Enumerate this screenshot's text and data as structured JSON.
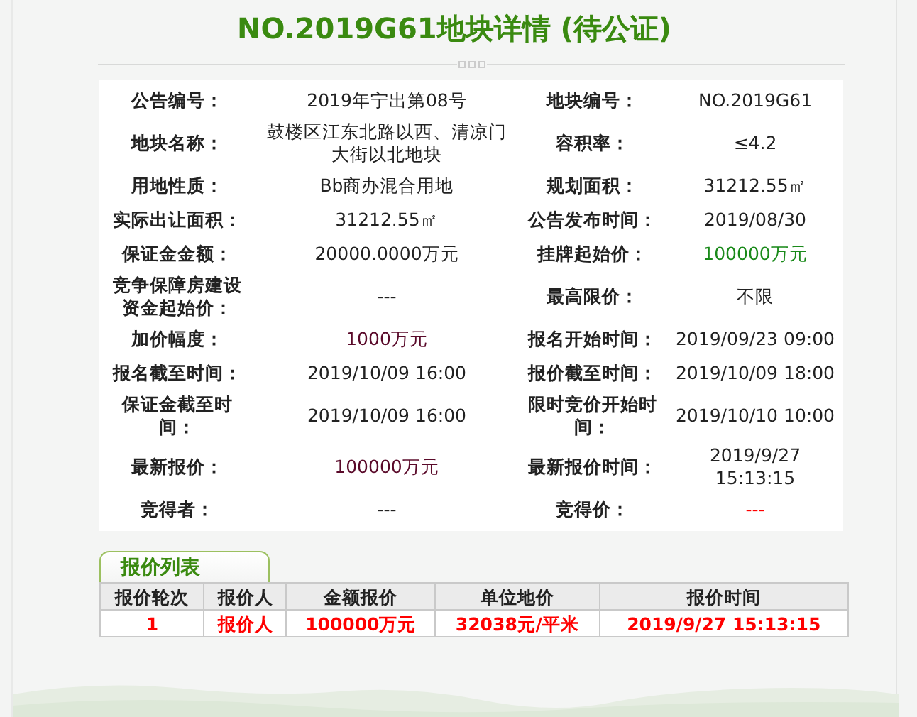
{
  "title": "NO.2019G61地块详情 (待公证)",
  "details": [
    {
      "left": {
        "label": "公告编号：",
        "value": "2019年宁出第08号"
      },
      "right": {
        "label": "地块编号：",
        "value": "NO.2019G61"
      }
    },
    {
      "left": {
        "label": "地块名称：",
        "value": "鼓楼区江东北路以西、清凉门大街以北地块"
      },
      "right": {
        "label": "容积率：",
        "value": "≤4.2"
      }
    },
    {
      "left": {
        "label": "用地性质：",
        "value": "Bb商办混合用地"
      },
      "right": {
        "label": "规划面积：",
        "value": "31212.55㎡"
      }
    },
    {
      "left": {
        "label": "实际出让面积：",
        "value": "31212.55㎡"
      },
      "right": {
        "label": "公告发布时间：",
        "value": "2019/08/30"
      }
    },
    {
      "left": {
        "label": "保证金金额：",
        "value": "20000.0000万元"
      },
      "right": {
        "label": "挂牌起始价：",
        "value": "100000万元",
        "color": "#1a8a1a"
      }
    },
    {
      "left": {
        "label": "竞争保障房建设资金起始价：",
        "value": "---"
      },
      "right": {
        "label": "最高限价：",
        "value": "不限"
      }
    },
    {
      "left": {
        "label": "加价幅度：",
        "value": "1000万元",
        "color": "#5a0a2a"
      },
      "right": {
        "label": "报名开始时间：",
        "value": "2019/09/23 09:00"
      }
    },
    {
      "left": {
        "label": "报名截至时间：",
        "value": "2019/10/09 16:00"
      },
      "right": {
        "label": "报价截至时间：",
        "value": "2019/10/09 18:00"
      }
    },
    {
      "left": {
        "label": "保证金截至时间：",
        "value": "2019/10/09 16:00"
      },
      "right": {
        "label": "限时竞价开始时间：",
        "value": "2019/10/10 10:00"
      }
    },
    {
      "left": {
        "label": "最新报价：",
        "value": "100000万元",
        "color": "#5a0a2a"
      },
      "right": {
        "label": "最新报价时间：",
        "value": "2019/9/27 15:13:15"
      }
    },
    {
      "left": {
        "label": "竞得者：",
        "value": "---"
      },
      "right": {
        "label": "竞得价：",
        "value": "---",
        "color": "#ff0000"
      }
    }
  ],
  "bids": {
    "tab": "报价列表",
    "columns": [
      "报价轮次",
      "报价人",
      "金额报价",
      "单位地价",
      "报价时间"
    ],
    "rows": [
      [
        "1",
        "报价人",
        "100000万元",
        "32038元/平米",
        "2019/9/27 15:13:15"
      ]
    ]
  }
}
